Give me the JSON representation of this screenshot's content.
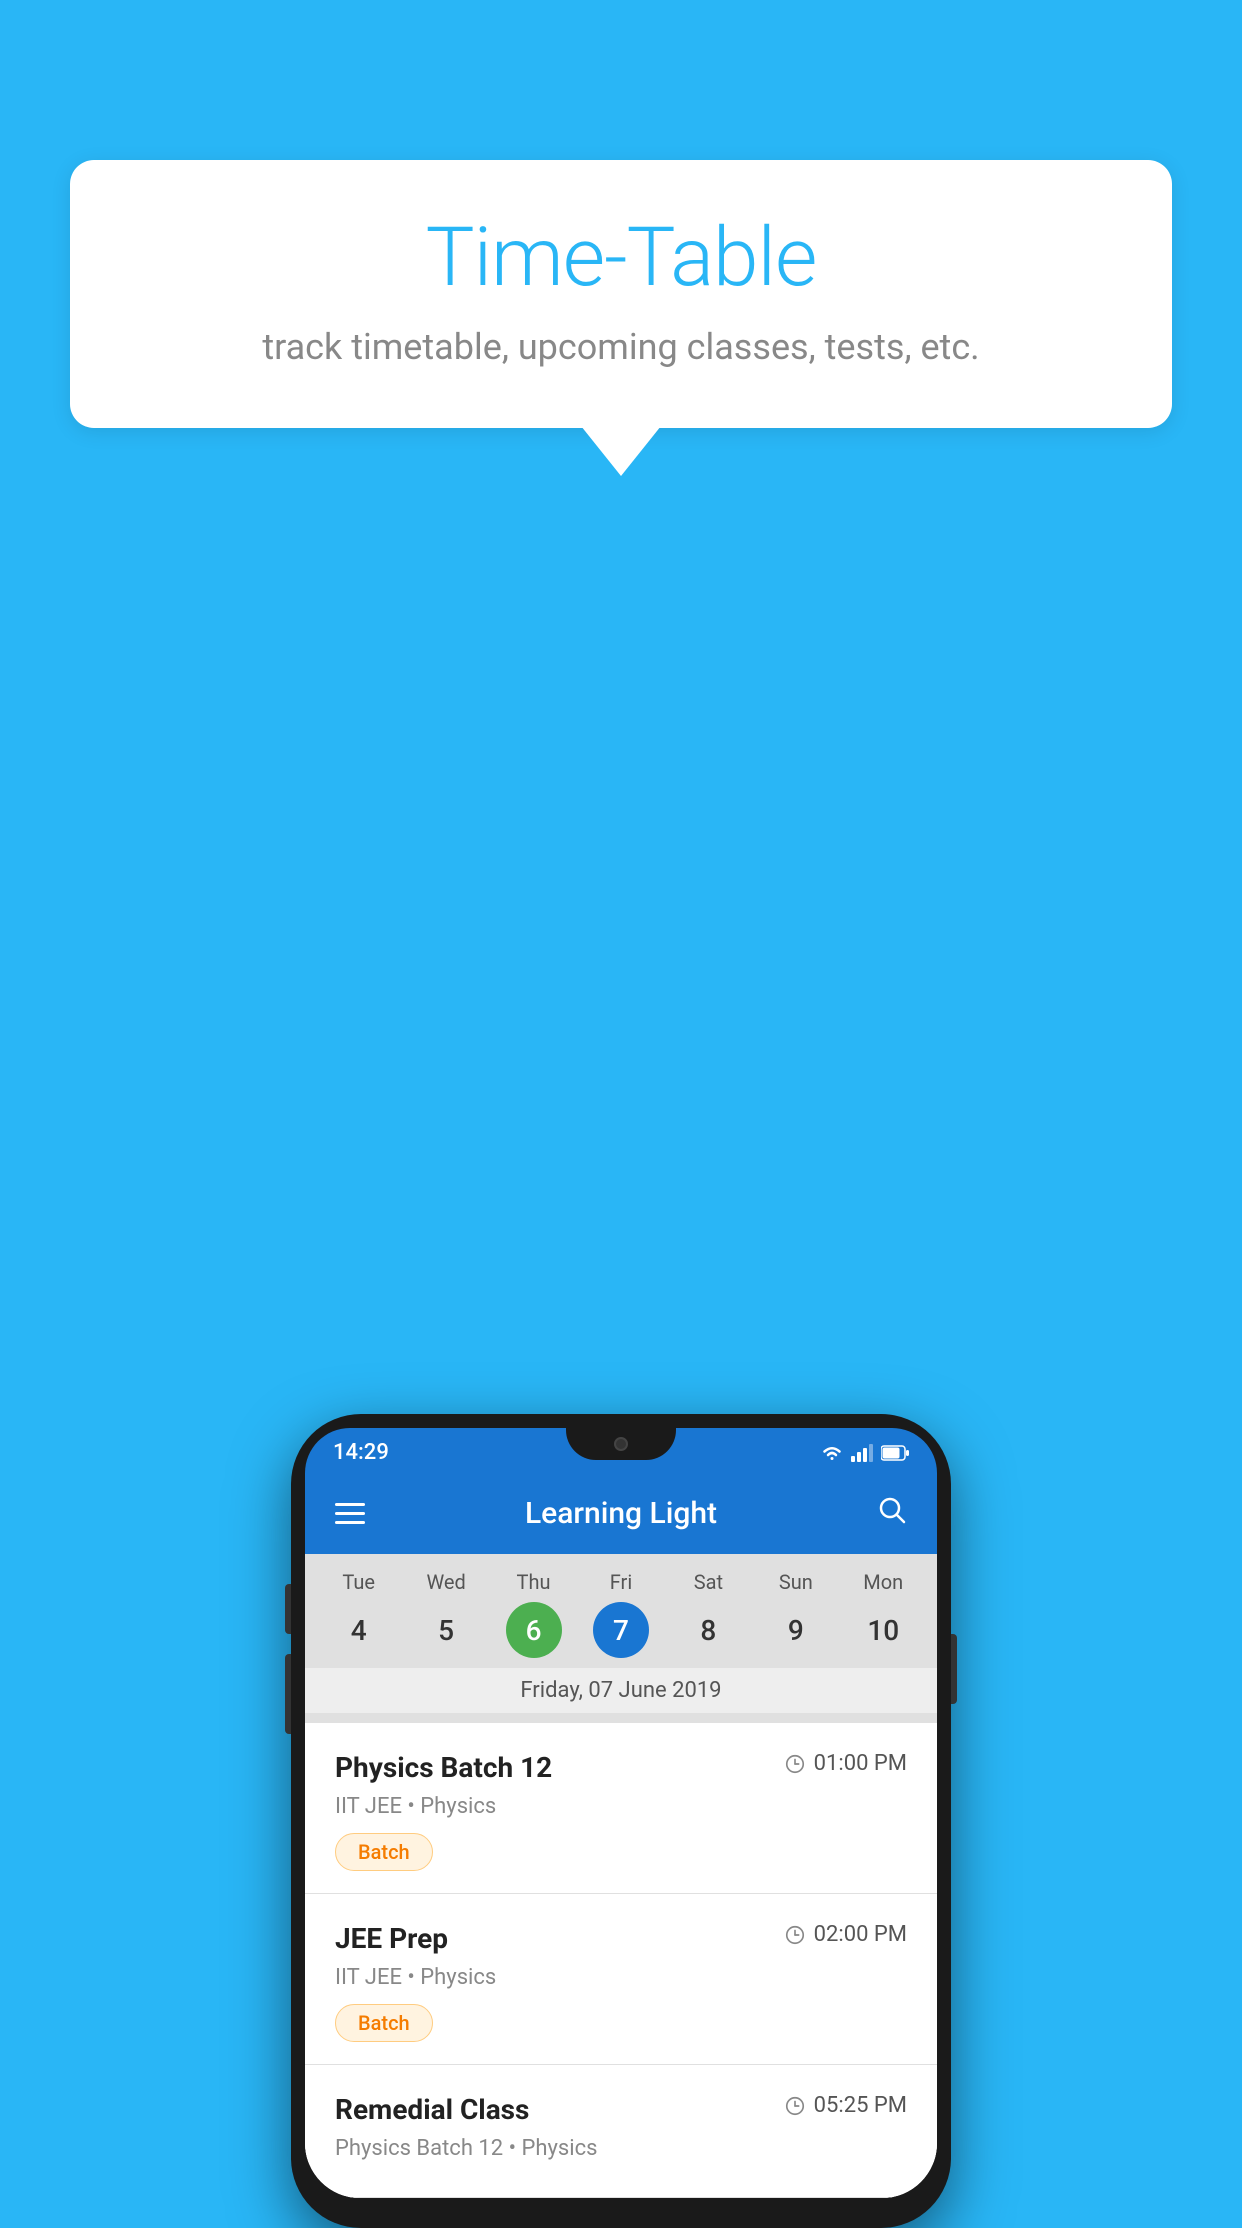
{
  "background_color": "#29B6F6",
  "speech_bubble": {
    "title": "Time-Table",
    "subtitle": "track timetable, upcoming classes, tests, etc."
  },
  "phone": {
    "status_bar": {
      "time": "14:29",
      "icons": [
        "wifi",
        "signal",
        "battery"
      ]
    },
    "app_bar": {
      "title": "Learning Light",
      "menu_icon": "hamburger-menu",
      "search_icon": "search"
    },
    "calendar": {
      "days": [
        {
          "label": "Tue",
          "number": "4",
          "state": "normal"
        },
        {
          "label": "Wed",
          "number": "5",
          "state": "normal"
        },
        {
          "label": "Thu",
          "number": "6",
          "state": "today"
        },
        {
          "label": "Fri",
          "number": "7",
          "state": "selected"
        },
        {
          "label": "Sat",
          "number": "8",
          "state": "normal"
        },
        {
          "label": "Sun",
          "number": "9",
          "state": "normal"
        },
        {
          "label": "Mon",
          "number": "10",
          "state": "normal"
        }
      ],
      "selected_date_label": "Friday, 07 June 2019"
    },
    "schedule": [
      {
        "title": "Physics Batch 12",
        "time": "01:00 PM",
        "subtitle": "IIT JEE • Physics",
        "badge": "Batch"
      },
      {
        "title": "JEE Prep",
        "time": "02:00 PM",
        "subtitle": "IIT JEE • Physics",
        "badge": "Batch"
      },
      {
        "title": "Remedial Class",
        "time": "05:25 PM",
        "subtitle": "Physics Batch 12 • Physics",
        "badge": null
      }
    ]
  }
}
